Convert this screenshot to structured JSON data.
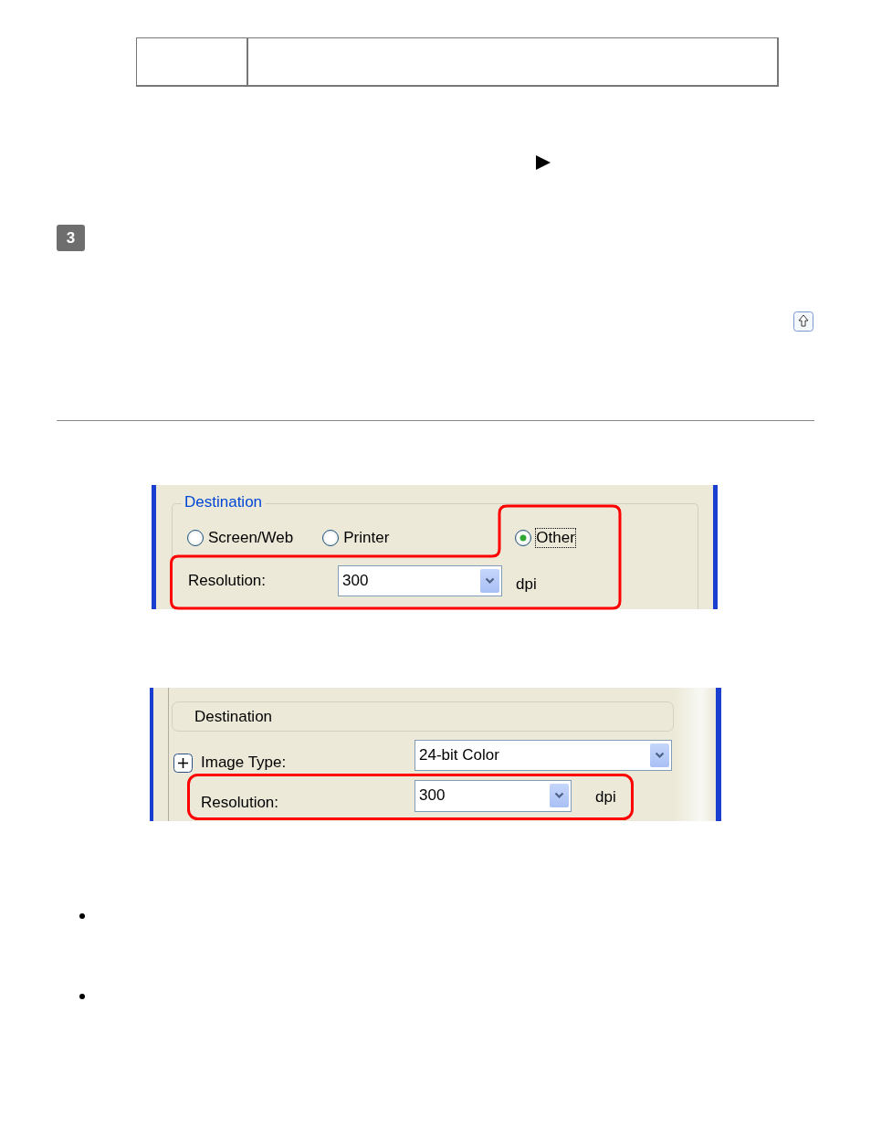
{
  "step": {
    "number": "3"
  },
  "screenshot_1": {
    "group_label": "Destination",
    "radios": [
      {
        "label": "Screen/Web",
        "selected": false
      },
      {
        "label": "Printer",
        "selected": false
      },
      {
        "label": "Other",
        "selected": true
      }
    ],
    "resolution": {
      "label": "Resolution:",
      "value": "300",
      "unit": "dpi"
    }
  },
  "screenshot_2": {
    "header": "Destination",
    "image_type": {
      "label": "Image Type:",
      "value": "24-bit Color"
    },
    "resolution": {
      "label": "Resolution:",
      "value": "300",
      "unit": "dpi"
    }
  },
  "bullets": [
    {
      "kind": "dot"
    },
    {
      "kind": "dot"
    }
  ]
}
